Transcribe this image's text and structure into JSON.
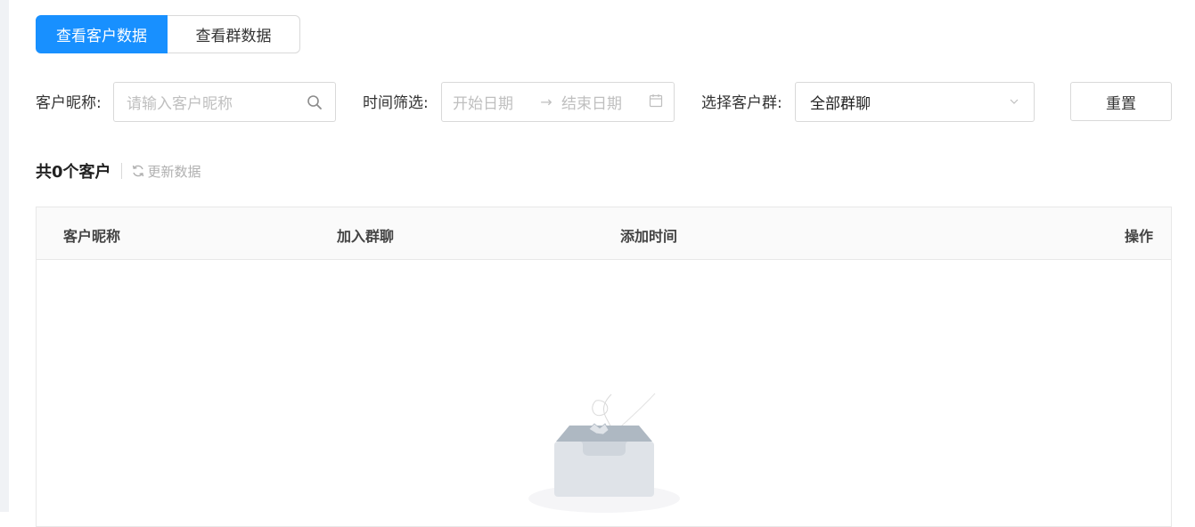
{
  "tabs": [
    {
      "label": "查看客户数据",
      "active": true
    },
    {
      "label": "查看群数据",
      "active": false
    }
  ],
  "filters": {
    "nickname_label": "客户昵称:",
    "nickname_placeholder": "请输入客户昵称",
    "time_label": "时间筛选:",
    "start_placeholder": "开始日期",
    "end_placeholder": "结束日期",
    "group_label": "选择客户群:",
    "group_value": "全部群聊",
    "reset_label": "重置"
  },
  "summary": {
    "count_text": "共0个客户",
    "refresh_label": "更新数据"
  },
  "table": {
    "columns": [
      "客户昵称",
      "加入群聊",
      "添加时间",
      "操作"
    ],
    "rows": []
  },
  "colors": {
    "primary": "#1890ff",
    "border": "#d9d9d9",
    "placeholder": "#bfbfbf"
  },
  "icons": [
    "search-icon",
    "calendar-icon",
    "chevron-down-icon",
    "refresh-icon",
    "empty-box-icon"
  ]
}
